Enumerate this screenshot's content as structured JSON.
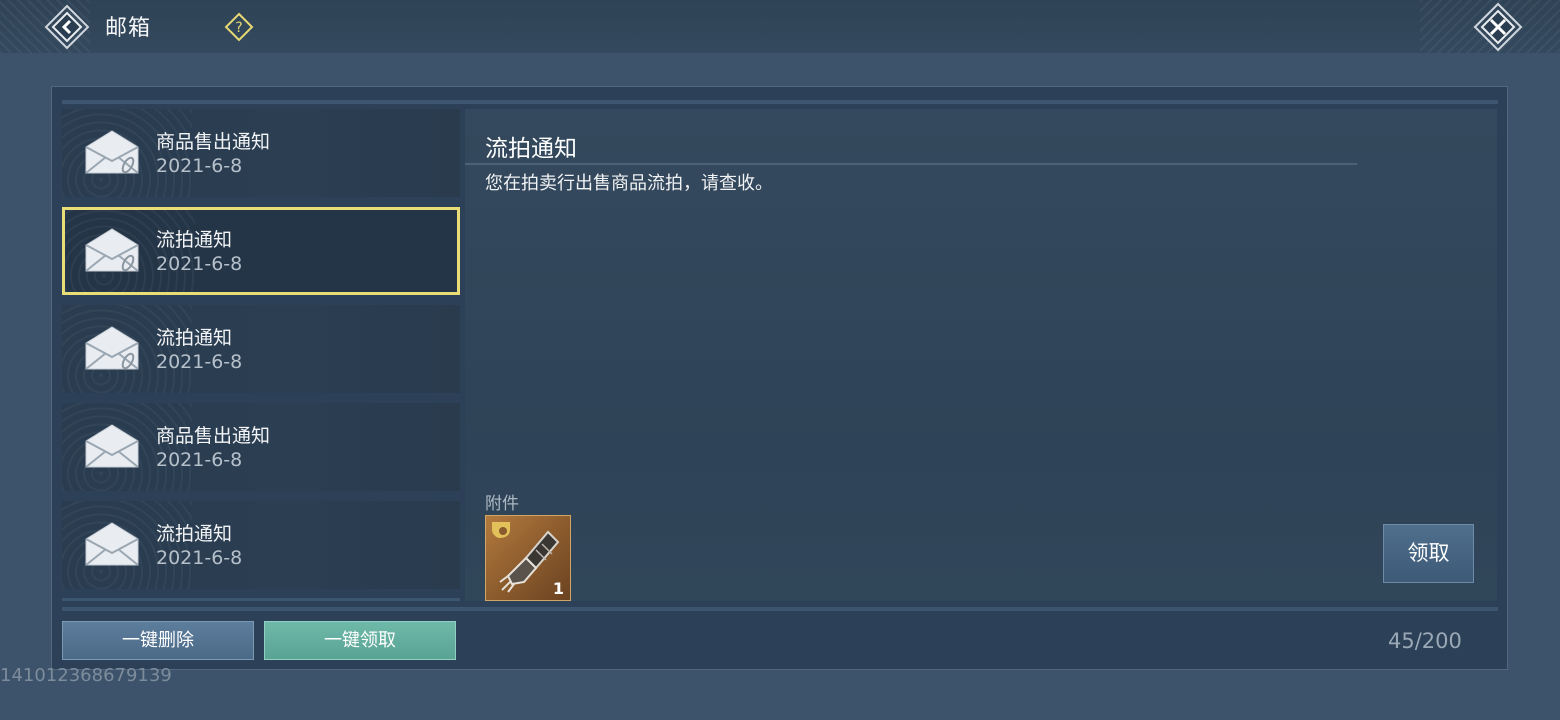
{
  "header": {
    "title": "邮箱",
    "back_icon": "back-arrow-icon",
    "help_icon": "question-diamond-icon",
    "close_icon": "close-x-icon"
  },
  "mail_list": {
    "items": [
      {
        "title": "商品售出通知",
        "date": "2021-6-8",
        "has_attachment": true,
        "selected": false
      },
      {
        "title": "流拍通知",
        "date": "2021-6-8",
        "has_attachment": true,
        "selected": true
      },
      {
        "title": "流拍通知",
        "date": "2021-6-8",
        "has_attachment": true,
        "selected": false
      },
      {
        "title": "商品售出通知",
        "date": "2021-6-8",
        "has_attachment": false,
        "selected": false
      },
      {
        "title": "流拍通知",
        "date": "2021-6-8",
        "has_attachment": false,
        "selected": false
      }
    ]
  },
  "detail": {
    "title": "流拍通知",
    "body": "您在拍卖行出售商品流拍，请查收。",
    "attachment_label": "附件",
    "attachment": {
      "icon": "gauntlet-item-icon",
      "count": "1"
    },
    "claim_label": "领取"
  },
  "footer": {
    "delete_all_label": "一键删除",
    "claim_all_label": "一键领取",
    "mail_count": "45/200"
  },
  "uid": "141012368679139",
  "colors": {
    "selected_border": "#e9dd78",
    "claim_all_bg": "#6fb9aa",
    "delete_bg": "#5d7d9c",
    "panel_bg": "#2c4158"
  }
}
